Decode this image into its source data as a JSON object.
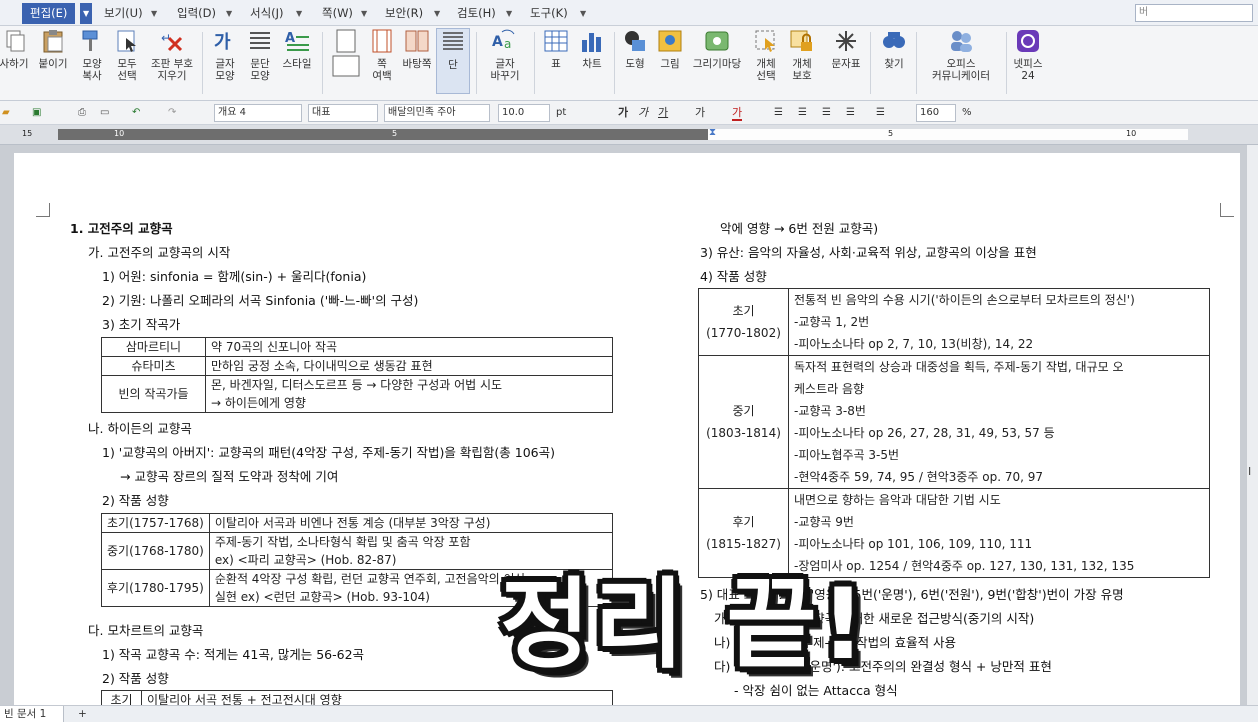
{
  "menu": {
    "items": [
      "편집(E)",
      "보기(U)",
      "입력(D)",
      "서식(J)",
      "쪽(W)",
      "보안(R)",
      "검토(H)",
      "도구(K)"
    ],
    "search_placeholder": "버"
  },
  "ribbon": {
    "buttons": [
      {
        "label": "사하기",
        "icon": "copy-icon"
      },
      {
        "label": "붙이기",
        "icon": "paste-icon"
      },
      {
        "label": "모양\n복사",
        "icon": "format-painter-icon"
      },
      {
        "label": "모두\n선택",
        "icon": "select-all-icon"
      },
      {
        "label": "조판 부호\n지우기",
        "icon": "clear-marks-icon"
      },
      {
        "label": "글자\n모양",
        "icon": "char-shape-icon"
      },
      {
        "label": "문단\n모양",
        "icon": "para-shape-icon"
      },
      {
        "label": "스타일",
        "icon": "style-icon"
      },
      {
        "label": "",
        "icon": "page-icon"
      },
      {
        "label": "쪽\n여백",
        "icon": "margin-icon"
      },
      {
        "label": "바탕쪽",
        "icon": "master-page-icon"
      },
      {
        "label": "단",
        "icon": "columns-icon"
      },
      {
        "label": "글자\n바꾸기",
        "icon": "replace-text-icon"
      },
      {
        "label": "표",
        "icon": "table-icon"
      },
      {
        "label": "차트",
        "icon": "chart-icon"
      },
      {
        "label": "도형",
        "icon": "shape-icon"
      },
      {
        "label": "그림",
        "icon": "picture-icon"
      },
      {
        "label": "그리기마당",
        "icon": "clipart-icon"
      },
      {
        "label": "개체\n선택",
        "icon": "object-select-icon"
      },
      {
        "label": "개체\n보호",
        "icon": "object-protect-icon"
      },
      {
        "label": "문자표",
        "icon": "symbol-icon"
      },
      {
        "label": "찾기",
        "icon": "find-icon"
      },
      {
        "label": "오피스\n커뮤니케이터",
        "icon": "office-communicator-icon"
      },
      {
        "label": "넷피스\n24",
        "icon": "netffice-icon"
      }
    ]
  },
  "format_toolbar": {
    "style": "개요 4",
    "font_lang": "대표",
    "font": "배달의민족 주아",
    "size": "10.0",
    "unit": "pt",
    "zoom": "160",
    "zoom_unit": "%",
    "bold": "가",
    "italic": "가",
    "underline": "가",
    "strike": "가",
    "color": "가"
  },
  "ruler": {
    "labels": [
      "15",
      "10",
      "5",
      "",
      "5",
      "10"
    ]
  },
  "document": {
    "left": {
      "l1": "1. 고전주의 교향곡",
      "l2": "가. 고전주의 교향곡의 시작",
      "l3": "1) 어원: sinfonia = 함께(sin-) + 울리다(fonia)",
      "l4": "2) 기원: 나폴리 오페라의 서곡 Sinfonia ('빠-느-빠'의 구성)",
      "l5": "3) 초기 작곡가",
      "table1": [
        [
          "삼마르티니",
          "약 70곡의 신포니아 작곡"
        ],
        [
          "슈타미츠",
          "만하임 궁정 소속, 다이내믹으로 생동감 표현"
        ],
        [
          "빈의 작곡가들",
          "몬, 바겐자일, 디터스도르프 등 → 다양한 구성과 어법 시도"
        ],
        [
          "",
          "→ 하이든에게 영향"
        ]
      ],
      "l6": "나. 하이든의 교향곡",
      "l7": "1) '교향곡의 아버지': 교향곡의 패턴(4악장 구성, 주제-동기 작법)을 확립함(총 106곡)",
      "l8": "→ 교향곡 장르의 질적 도약과 정착에 기여",
      "l9": "2) 작품 성향",
      "table2": [
        [
          "초기(1757-1768)",
          "이탈리아 서곡과 비엔나 전통 계승 (대부분 3악장 구성)"
        ],
        [
          "중기(1768-1780)",
          "주제-동기 작법, 소나타형식 확립 및 춤곡 악장 포함"
        ],
        [
          "",
          "ex) <파리 교향곡> (Hob. 82-87)"
        ],
        [
          "후기(1780-1795)",
          "순환적 4악장 구성 확립, 런던 교향곡 연주회, 고전음악의 이상"
        ],
        [
          "",
          "실현 ex) <런던 교향곡> (Hob. 93-104)"
        ]
      ],
      "l10": "다. 모차르트의 교향곡",
      "l11": "1) 작곡 교향곡 수: 적게는 41곡, 많게는 56-62곡",
      "l12": "2) 작품 성향",
      "table3": [
        [
          "초기",
          "이탈리아 서곡 전통 + 전고전시대 영향"
        ]
      ]
    },
    "right": {
      "r1": "악에 영향 → 6번 전원 교향곡)",
      "r2": "3) 유산: 음악의 자율성, 사회·교육적 위상, 교향곡의 이상을 표현",
      "r3": "4) 작품 성향",
      "table4": [
        {
          "period": "초기",
          "years": "(1770-1802)",
          "rows": [
            "전통적 빈 음악의 수용 시기('하이든의 손으로부터 모차르트의 정신')",
            "-교향곡 1, 2번",
            "-피아노소나타 op 2, 7, 10, 13(비창), 14, 22"
          ]
        },
        {
          "period": "중기",
          "years": "(1803-1814)",
          "rows": [
            "독자적 표현력의 상승과 대중성을 획득, 주제-동기 작법, 대규모 오",
            "케스트라 음향",
            "-교향곡 3-8번",
            "-피아노소나타 op 26, 27, 28, 31, 49, 53, 57 등",
            "-피아노협주곡 3-5번",
            "-현악4중주 59, 74, 95 / 현악3중주 op. 70, 97"
          ]
        },
        {
          "period": "후기",
          "years": "(1815-1827)",
          "rows": [
            "내면으로 향하는 음악과 대담한 기법 시도",
            "-교향곡 9번",
            "-피아노소나타 op 101, 106, 109, 110, 111",
            "-장엄미사 op. 1254 / 현악4중주 op. 127, 130, 131, 132, 135"
          ]
        }
      ],
      "r4": "5) 대표 교향곡: 3번('영웅'), 5번('운명'), 6번('전원'), 9번('합창')번이 가장 유명",
      "r5": "가) 3번('영웅'): 교향곡에 대한 새로운 접근방식(중기의 시작)",
      "r6": "나) 5번('운명'): 주제-동기 작법의 효율적 사용",
      "r7": "다) 5번(op. 67, '운명'): 고전주의의 완결성 형식 + 낭만적 표현",
      "r8": "- 악장 쉼이 없는 Attacca 형식"
    }
  },
  "overlay": {
    "text": "정리 끝!"
  },
  "status": {
    "doc_tab": "빈 문서 1",
    "add_tab": "+"
  }
}
